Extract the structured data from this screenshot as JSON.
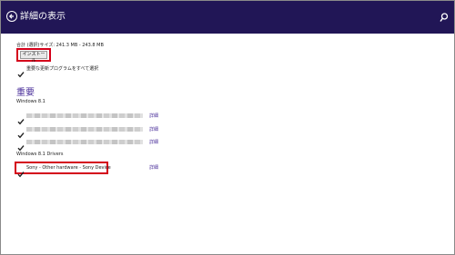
{
  "header": {
    "title": "詳細の表示",
    "back_icon": "back-arrow-icon",
    "search_icon": "search-icon"
  },
  "summary": {
    "total_size_text": "合計 (選択)サイズ: 241.3 MB - 243.8 MB",
    "install_label": "インストール",
    "option_label": "重要な更新プログラムをすべて選択"
  },
  "section": {
    "title": "重要"
  },
  "groups": {
    "windows81": {
      "label": "Windows 8.1"
    },
    "drivers": {
      "label": "Windows 8.1 Drivers"
    }
  },
  "updates": [
    {
      "name_hidden": true,
      "checked": true,
      "detail": "詳細"
    },
    {
      "name_hidden": true,
      "checked": true,
      "detail": "詳細"
    },
    {
      "name_hidden": true,
      "checked": true,
      "detail": "詳細"
    }
  ],
  "driver_update": {
    "name": "Sony - Other hardware - Sony Device",
    "checked": true,
    "detail": "詳細"
  },
  "colors": {
    "header_bg": "#211656",
    "accent": "#4a2f9a",
    "highlight": "#d4001a"
  }
}
